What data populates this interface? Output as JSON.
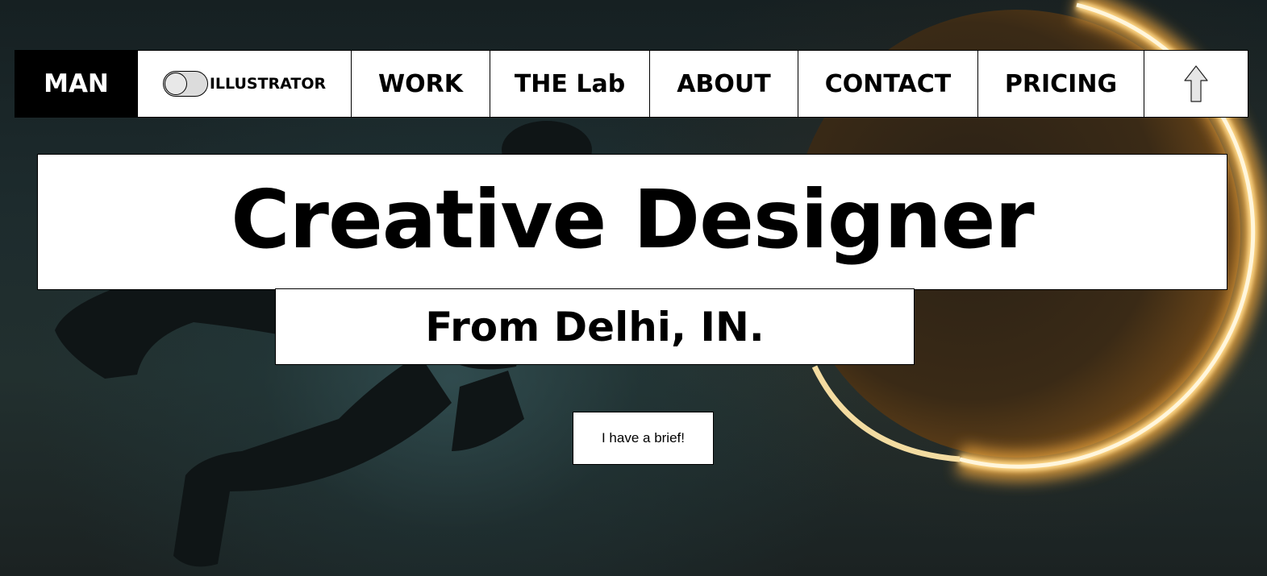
{
  "nav": {
    "brand": "MAN",
    "mode_label": "ILLUSTRATOR",
    "items": [
      {
        "label": "WORK"
      },
      {
        "label": "THE Lab"
      },
      {
        "label": "ABOUT"
      },
      {
        "label": "CONTACT"
      },
      {
        "label": "PRICING"
      }
    ],
    "up_icon": "arrow-up-icon"
  },
  "hero": {
    "title": "Creative Designer",
    "subtitle": "From Delhi, IN.",
    "cta_label": "I have a brief!"
  },
  "colors": {
    "nav_bg": "#ffffff",
    "brand_bg": "#000000",
    "brand_text": "#ffffff",
    "text": "#000000",
    "ring_glow": "#ffe6a8"
  }
}
